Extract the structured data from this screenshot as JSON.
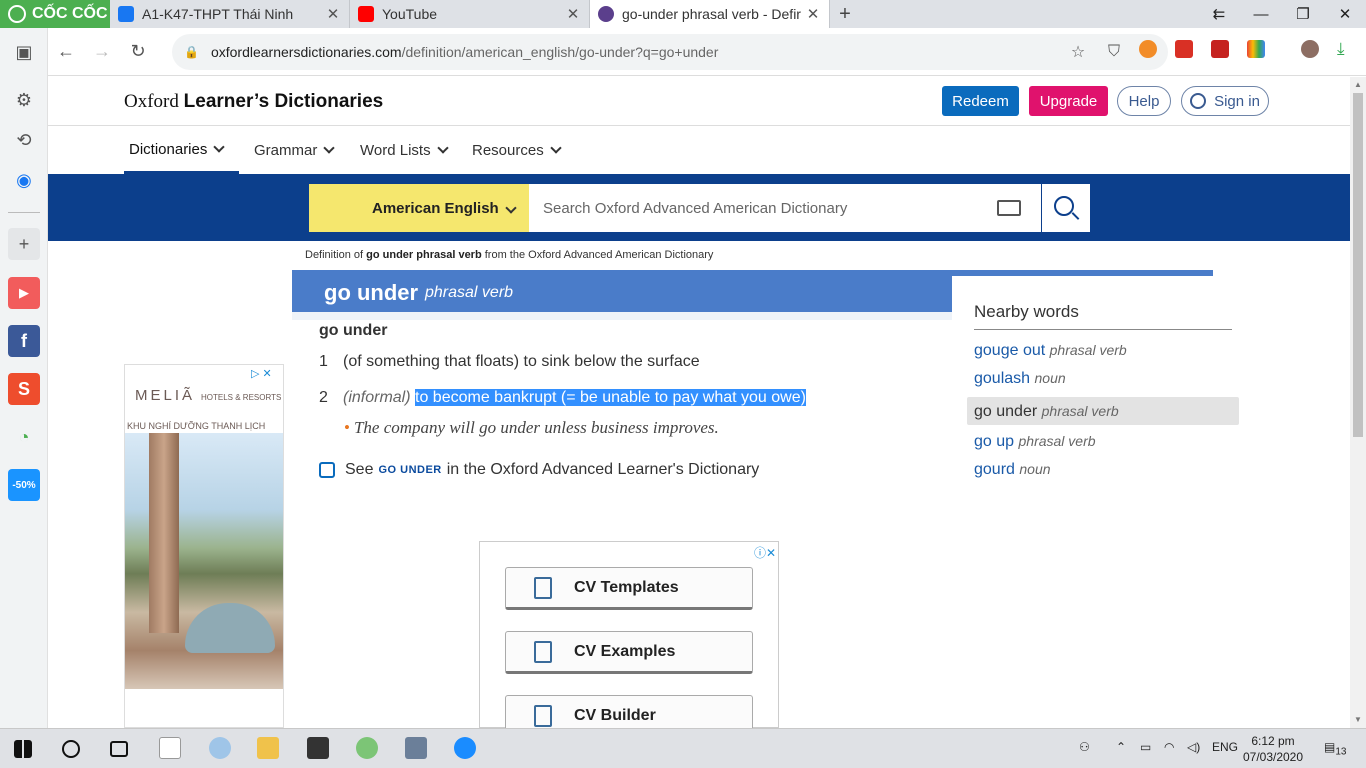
{
  "browser": {
    "brand": "CỐC CỐC",
    "tabs": [
      {
        "title": "A1-K47-THPT Thái Ninh",
        "active": false,
        "favicon_color": "#1877f2"
      },
      {
        "title": "YouTube",
        "active": false,
        "favicon_color": "#ff0000"
      },
      {
        "title": "go-under phrasal verb - Defir",
        "active": true,
        "favicon_color": "#5b3f8c"
      }
    ],
    "url": {
      "host": "oxfordlearnersdictionaries.com",
      "path": "/definition/american_english/go-under?q=go+under"
    }
  },
  "site": {
    "logo_regular": "Oxford ",
    "logo_bold": "Learner’s Dictionaries",
    "buttons": {
      "redeem": "Redeem",
      "upgrade": "Upgrade",
      "help": "Help",
      "signin": "Sign in"
    },
    "nav": [
      "Dictionaries",
      "Grammar",
      "Word Lists",
      "Resources"
    ],
    "search": {
      "dictionary": "American English",
      "placeholder": "Search Oxford Advanced American Dictionary"
    }
  },
  "entry": {
    "source_prefix": "Definition of ",
    "source_term": "go under phrasal verb",
    "source_suffix": " from the Oxford Advanced American Dictionary",
    "headword": "go under",
    "pos": "phrasal verb",
    "phrasal": "go under",
    "senses": [
      {
        "num": "1",
        "label": "",
        "definition": "(of something that floats) to sink below the surface"
      },
      {
        "num": "2",
        "label": "(informal)",
        "definition": "to become bankrupt (= be unable to pay what you owe)"
      }
    ],
    "example": "The company will go under unless business improves.",
    "see_also": {
      "prefix": "See",
      "term": "GO UNDER",
      "suffix": "in the Oxford Advanced Learner's Dictionary"
    }
  },
  "nearby": {
    "title": "Nearby words",
    "items": [
      {
        "word": "gouge out",
        "pos": "phrasal verb",
        "selected": false
      },
      {
        "word": "goulash",
        "pos": "noun",
        "selected": false
      },
      {
        "word": "go under",
        "pos": "phrasal verb",
        "selected": true
      },
      {
        "word": "go up",
        "pos": "phrasal verb",
        "selected": false
      },
      {
        "word": "gourd",
        "pos": "noun",
        "selected": false
      }
    ]
  },
  "ads": {
    "left": {
      "brand": "MELIÃ",
      "sub": "HOTELS & RESORTS",
      "headline": "KHU NGHỈ DƯỠNG THANH LỊCH"
    },
    "center": {
      "buttons": [
        "CV Templates",
        "CV Examples",
        "CV Builder"
      ]
    }
  },
  "taskbar": {
    "lang": "ENG",
    "time": "6:12 pm",
    "date": "07/03/2020",
    "notif_count": "13"
  }
}
